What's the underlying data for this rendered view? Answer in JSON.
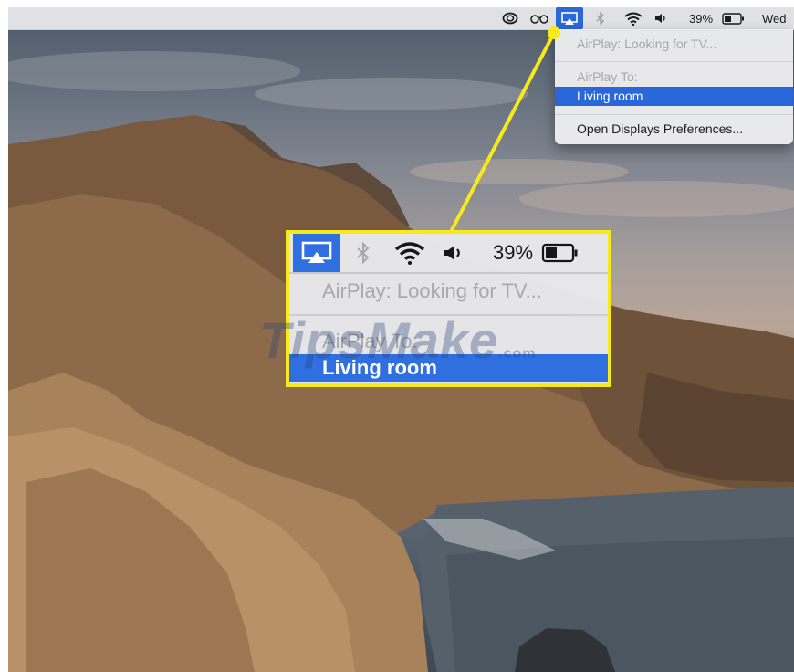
{
  "menubar": {
    "battery_percent": "39%",
    "clock": "Wed",
    "icons": [
      "creative-cloud-icon",
      "reading-glasses-icon",
      "airplay-icon",
      "bluetooth-icon",
      "wifi-icon",
      "volume-icon",
      "battery-icon"
    ]
  },
  "airplay_menu": {
    "status": "AirPlay: Looking for TV...",
    "header": "AirPlay To:",
    "selected_device": "Living room",
    "preferences": "Open Displays Preferences..."
  },
  "callout": {
    "battery_percent": "39%",
    "status": "AirPlay: Looking for TV...",
    "header": "AirPlay To:",
    "selected_device": "Living room",
    "border_color": "#f7ea1c"
  },
  "watermark": {
    "text": "TipsMake",
    "suffix": ".com"
  },
  "colors": {
    "selection": "#2a67d9",
    "highlight": "#f7ea1c",
    "disabled_text": "#a7a7aa"
  }
}
